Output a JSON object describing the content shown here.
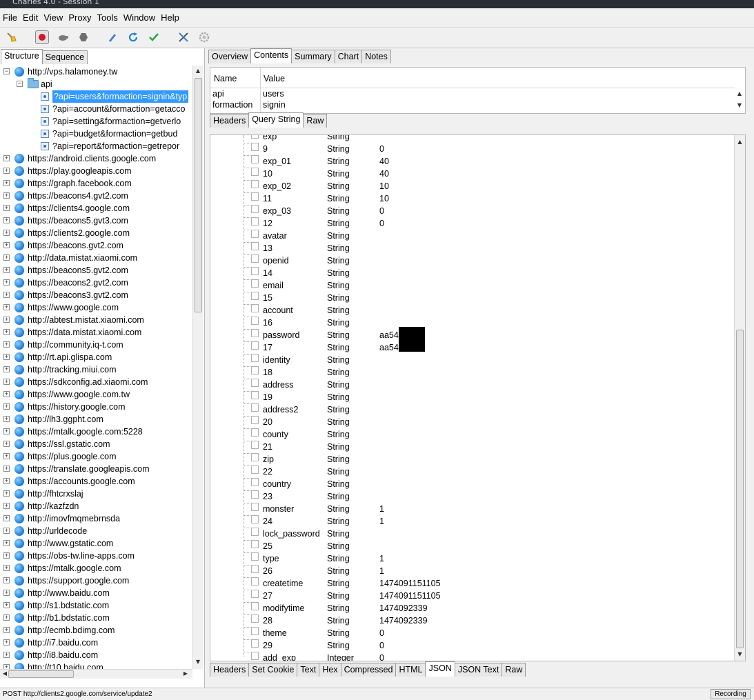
{
  "window": {
    "title": "Charles 4.0 - Session 1"
  },
  "menu": [
    "File",
    "Edit",
    "View",
    "Proxy",
    "Tools",
    "Window",
    "Help"
  ],
  "toolbar": {
    "icons": [
      "broom-icon",
      "record-icon",
      "throttle-turtle-icon",
      "breakpoint-hexagon-icon",
      "compose-pen-icon",
      "repeat-icon",
      "validate-check-icon",
      "tools-icon",
      "settings-gear-icon"
    ],
    "colors": {
      "record": "#d0192b",
      "repeat": "#1d86d6",
      "check": "#2aa84a"
    }
  },
  "left_tabs": [
    "Structure",
    "Sequence"
  ],
  "tree": {
    "root": "http://vps.halamoney.tw",
    "folder": "api",
    "requests": [
      "?api=users&formaction=signin&typ",
      "?api=account&formaction=getacco",
      "?api=setting&formaction=getverlo",
      "?api=budget&formaction=getbud",
      "?api=report&formaction=getrepor"
    ],
    "hosts": [
      "https://android.clients.google.com",
      "https://play.googleapis.com",
      "https://graph.facebook.com",
      "https://beacons4.gvt2.com",
      "https://clients4.google.com",
      "https://beacons5.gvt3.com",
      "https://clients2.google.com",
      "https://beacons.gvt2.com",
      "http://data.mistat.xiaomi.com",
      "https://beacons5.gvt2.com",
      "https://beacons2.gvt2.com",
      "https://beacons3.gvt2.com",
      "https://www.google.com",
      "http://abtest.mistat.xiaomi.com",
      "https://data.mistat.xiaomi.com",
      "http://community.iq-t.com",
      "http://rt.api.glispa.com",
      "http://tracking.miui.com",
      "https://sdkconfig.ad.xiaomi.com",
      "https://www.google.com.tw",
      "https://history.google.com",
      "http://lh3.ggpht.com",
      "https://mtalk.google.com:5228",
      "https://ssl.gstatic.com",
      "https://plus.google.com",
      "https://translate.googleapis.com",
      "https://accounts.google.com",
      "http://fhtcrxslaj",
      "http://kazfzdn",
      "http://imovfmqmebrnsda",
      "http://urldecode",
      "http://www.gstatic.com",
      "https://obs-tw.line-apps.com",
      "https://mtalk.google.com",
      "https://support.google.com",
      "http://www.baidu.com",
      "http://s1.bdstatic.com",
      "http://b1.bdstatic.com",
      "http://ecmb.bdimg.com",
      "http://i7.baidu.com",
      "http://i8.baidu.com",
      "http://t10.baidu.com"
    ]
  },
  "top_tabs": [
    "Overview",
    "Contents",
    "Summary",
    "Chart",
    "Notes"
  ],
  "query": {
    "columns": [
      "Name",
      "Value"
    ],
    "rows": [
      {
        "name": "api",
        "value": "users"
      },
      {
        "name": "formaction",
        "value": "signin"
      }
    ]
  },
  "request_tabs": [
    "Headers",
    "Query String",
    "Raw"
  ],
  "json_rows": [
    {
      "name": "exp",
      "type": "String",
      "value": ""
    },
    {
      "name": "9",
      "type": "String",
      "value": "0"
    },
    {
      "name": "exp_01",
      "type": "String",
      "value": "40"
    },
    {
      "name": "10",
      "type": "String",
      "value": "40"
    },
    {
      "name": "exp_02",
      "type": "String",
      "value": "10"
    },
    {
      "name": "11",
      "type": "String",
      "value": "10"
    },
    {
      "name": "exp_03",
      "type": "String",
      "value": "0"
    },
    {
      "name": "12",
      "type": "String",
      "value": "0"
    },
    {
      "name": "avatar",
      "type": "String",
      "value": ""
    },
    {
      "name": "13",
      "type": "String",
      "value": ""
    },
    {
      "name": "openid",
      "type": "String",
      "value": ""
    },
    {
      "name": "14",
      "type": "String",
      "value": ""
    },
    {
      "name": "email",
      "type": "String",
      "value": ""
    },
    {
      "name": "15",
      "type": "String",
      "value": ""
    },
    {
      "name": "account",
      "type": "String",
      "value": ""
    },
    {
      "name": "16",
      "type": "String",
      "value": ""
    },
    {
      "name": "password",
      "type": "String",
      "value": "aa54"
    },
    {
      "name": "17",
      "type": "String",
      "value": "aa54"
    },
    {
      "name": "identity",
      "type": "String",
      "value": ""
    },
    {
      "name": "18",
      "type": "String",
      "value": ""
    },
    {
      "name": "address",
      "type": "String",
      "value": ""
    },
    {
      "name": "19",
      "type": "String",
      "value": ""
    },
    {
      "name": "address2",
      "type": "String",
      "value": ""
    },
    {
      "name": "20",
      "type": "String",
      "value": ""
    },
    {
      "name": "county",
      "type": "String",
      "value": ""
    },
    {
      "name": "21",
      "type": "String",
      "value": ""
    },
    {
      "name": "zip",
      "type": "String",
      "value": ""
    },
    {
      "name": "22",
      "type": "String",
      "value": ""
    },
    {
      "name": "country",
      "type": "String",
      "value": ""
    },
    {
      "name": "23",
      "type": "String",
      "value": ""
    },
    {
      "name": "monster",
      "type": "String",
      "value": "1"
    },
    {
      "name": "24",
      "type": "String",
      "value": "1"
    },
    {
      "name": "lock_password",
      "type": "String",
      "value": ""
    },
    {
      "name": "25",
      "type": "String",
      "value": ""
    },
    {
      "name": "type",
      "type": "String",
      "value": "1"
    },
    {
      "name": "26",
      "type": "String",
      "value": "1"
    },
    {
      "name": "createtime",
      "type": "String",
      "value": "1474091151105"
    },
    {
      "name": "27",
      "type": "String",
      "value": "1474091151105"
    },
    {
      "name": "modifytime",
      "type": "String",
      "value": "1474092339"
    },
    {
      "name": "28",
      "type": "String",
      "value": "1474092339"
    },
    {
      "name": "theme",
      "type": "String",
      "value": "0"
    },
    {
      "name": "29",
      "type": "String",
      "value": "0"
    },
    {
      "name": "add_exp",
      "type": "Integer",
      "value": "0"
    }
  ],
  "response_tabs": [
    "Headers",
    "Set Cookie",
    "Text",
    "Hex",
    "Compressed",
    "HTML",
    "JSON",
    "JSON Text",
    "Raw"
  ],
  "status": {
    "text": "POST http://clients2.google.com/service/update2",
    "recording": "Recording"
  }
}
